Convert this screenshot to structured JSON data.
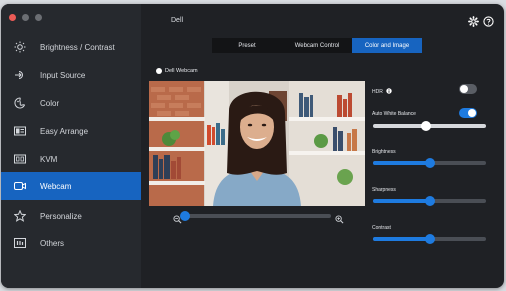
{
  "app": {
    "title": "Dell"
  },
  "sidebar": {
    "items": [
      {
        "label": "Brightness / Contrast",
        "icon": "sun-icon"
      },
      {
        "label": "Input Source",
        "icon": "input-source-icon"
      },
      {
        "label": "Color",
        "icon": "color-palette-icon"
      },
      {
        "label": "Easy Arrange",
        "icon": "easy-arrange-icon"
      },
      {
        "label": "KVM",
        "icon": "kvm-icon"
      },
      {
        "label": "Webcam",
        "icon": "webcam-icon"
      },
      {
        "label": "Personalize",
        "icon": "star-icon"
      },
      {
        "label": "Others",
        "icon": "others-icon"
      }
    ],
    "active": "Webcam"
  },
  "tabs": [
    {
      "label": "Preset"
    },
    {
      "label": "Webcam Control"
    },
    {
      "label": "Color and Image"
    }
  ],
  "selected_tab": "Color and Image",
  "camera": {
    "label": "Dell Webcam"
  },
  "controls": {
    "hdr": {
      "label": "HDR",
      "on": false
    },
    "awb": {
      "label": "Auto White Balance",
      "on": true,
      "value": 0.47
    },
    "brightness": {
      "label": "Brightness",
      "value": 0.5
    },
    "sharpness": {
      "label": "Sharpness",
      "value": 0.5
    },
    "contrast": {
      "label": "Contrast",
      "value": 0.5
    },
    "zoom": {
      "value": 0.0
    }
  },
  "colors": {
    "accent": "#1764c0",
    "slider": "#1e7be0"
  }
}
